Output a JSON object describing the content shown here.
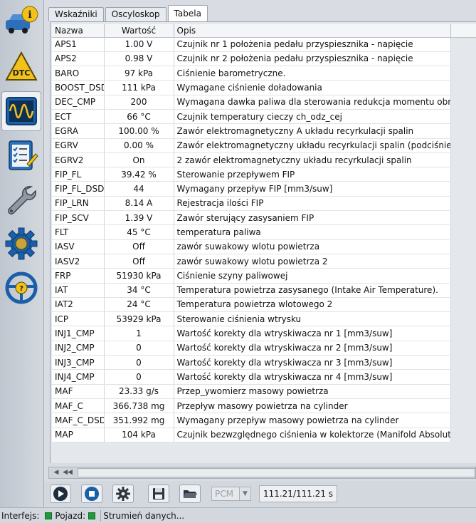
{
  "tabs": [
    "Wskaźniki",
    "Oscyloskop",
    "Tabela"
  ],
  "active_tab": 2,
  "table": {
    "headers": [
      "Nazwa",
      "Wartość",
      "Opis"
    ],
    "rows": [
      [
        "APS1",
        "1.00 V",
        "Czujnik nr 1 położenia pedału przyspiesznika - napięcie"
      ],
      [
        "APS2",
        "0.98 V",
        "Czujnik nr 2 położenia pedału przyspiesznika - napięcie"
      ],
      [
        "BARO",
        "97 kPa",
        "Ciśnienie barometryczne."
      ],
      [
        "BOOST_DSD",
        "111 kPa",
        "Wymagane ciśnienie doładowania"
      ],
      [
        "DEC_CMP",
        "200",
        "Wymagana dawka paliwa dla sterowania redukcja momentu obroto"
      ],
      [
        "ECT",
        "66 °C",
        "Czujnik temperatury cieczy ch_odz_cej"
      ],
      [
        "EGRA",
        "100.00 %",
        "Zawór elektromagnetyczny A układu recyrkulacji spalin"
      ],
      [
        "EGRV",
        "0.00 %",
        "Zawór elektromagnetyczny układu recyrkulacji spalin (podciśnienie)"
      ],
      [
        "EGRV2",
        "On",
        "2 zawór elektromagnetyczny układu recyrkulacji spalin"
      ],
      [
        "FIP_FL",
        "39.42 %",
        "Sterowanie przepływem FIP"
      ],
      [
        "FIP_FL_DSD",
        "44",
        "Wymagany przepływ FIP [mm3/suw]"
      ],
      [
        "FIP_LRN",
        "8.14 A",
        "Rejestracja ilości FIP"
      ],
      [
        "FIP_SCV",
        "1.39 V",
        "Zawór sterujący zasysaniem FIP"
      ],
      [
        "FLT",
        "45 °C",
        "temperatura paliwa"
      ],
      [
        "IASV",
        "Off",
        "zawór suwakowy wlotu powietrza"
      ],
      [
        "IASV2",
        "Off",
        "zawór suwakowy wlotu powietrza 2"
      ],
      [
        "FRP",
        "51930 kPa",
        "Ciśnienie szyny paliwowej"
      ],
      [
        "IAT",
        "34 °C",
        "Temperatura powietrza zasysanego (Intake Air Temperature)."
      ],
      [
        "IAT2",
        "24 °C",
        "Temperatura powietrza wlotowego 2"
      ],
      [
        "ICP",
        "53929 kPa",
        "Sterowanie ciśnienia wtrysku"
      ],
      [
        "INJ1_CMP",
        "1",
        "Wartość korekty dla wtryskiwacza nr 1 [mm3/suw]"
      ],
      [
        "INJ2_CMP",
        "0",
        "Wartość korekty dla wtryskiwacza nr 2 [mm3/suw]"
      ],
      [
        "INJ3_CMP",
        "0",
        "Wartość korekty dla wtryskiwacza nr 3 [mm3/suw]"
      ],
      [
        "INJ4_CMP",
        "0",
        "Wartość korekty dla wtryskiwacza nr 4 [mm3/suw]"
      ],
      [
        "MAF",
        "23.33 g/s",
        "Przep_ywomierz masowy powietrza"
      ],
      [
        "MAF_C",
        "366.738 mg",
        "Przepływ masowy powietrza na cylinder"
      ],
      [
        "MAF_C_DSD",
        "351.992 mg",
        "Wymagany przepływ masowy powietrza na cylinder"
      ],
      [
        "MAP",
        "104 kPa",
        "Czujnik bezwzględnego ciśnienia w kolektorze (Manifold AbsolutePr"
      ]
    ]
  },
  "sidebar": {
    "items": [
      {
        "icon": "car-info-icon",
        "name": "sidebar-item-vehicle-info"
      },
      {
        "icon": "dtc-warning-icon",
        "name": "sidebar-item-dtc"
      },
      {
        "icon": "oscilloscope-icon",
        "name": "sidebar-item-live-data"
      },
      {
        "icon": "checklist-icon",
        "name": "sidebar-item-tests"
      },
      {
        "icon": "wrench-icon",
        "name": "sidebar-item-service"
      },
      {
        "icon": "gear-icon",
        "name": "sidebar-item-settings"
      },
      {
        "icon": "steering-help-icon",
        "name": "sidebar-item-help"
      }
    ]
  },
  "toolbar": {
    "pcm_label": "PCM",
    "time": "111.21/111.21 s"
  },
  "status": {
    "interface_label": "Interfejs:",
    "vehicle_label": "Pojazd:",
    "stream_label": "Strumień danych..."
  },
  "colors": {
    "accent_blue": "#1a5fa8",
    "led_green": "#1f9a3a",
    "dtc_yellow": "#f2c21b"
  }
}
